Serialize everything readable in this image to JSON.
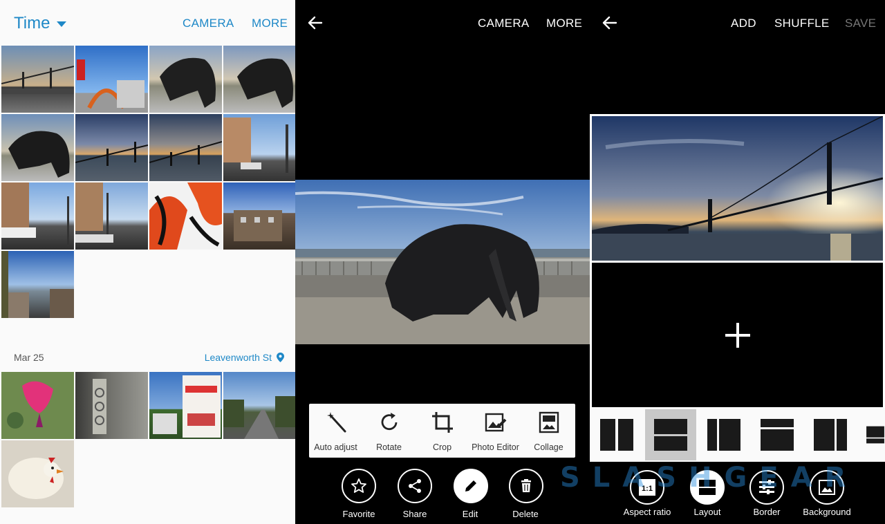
{
  "gallery": {
    "title": "Time",
    "actions": [
      "CAMERA",
      "MORE"
    ],
    "group_date": "Mar 25",
    "group_location": "Leavenworth St"
  },
  "viewer": {
    "actions": [
      "CAMERA",
      "MORE"
    ],
    "edit_menu": [
      "Auto adjust",
      "Rotate",
      "Crop",
      "Photo Editor",
      "Collage"
    ],
    "bottom_actions": [
      "Favorite",
      "Share",
      "Edit",
      "Delete"
    ]
  },
  "collage": {
    "actions": [
      "ADD",
      "SHUFFLE",
      "SAVE"
    ],
    "tools": [
      "Aspect ratio",
      "Layout",
      "Border",
      "Background"
    ],
    "aspect_ratio_value": "1:1"
  },
  "watermark": "SLASHGEAR",
  "colors": {
    "accent": "#1e88c7",
    "disabled": "#777777"
  }
}
